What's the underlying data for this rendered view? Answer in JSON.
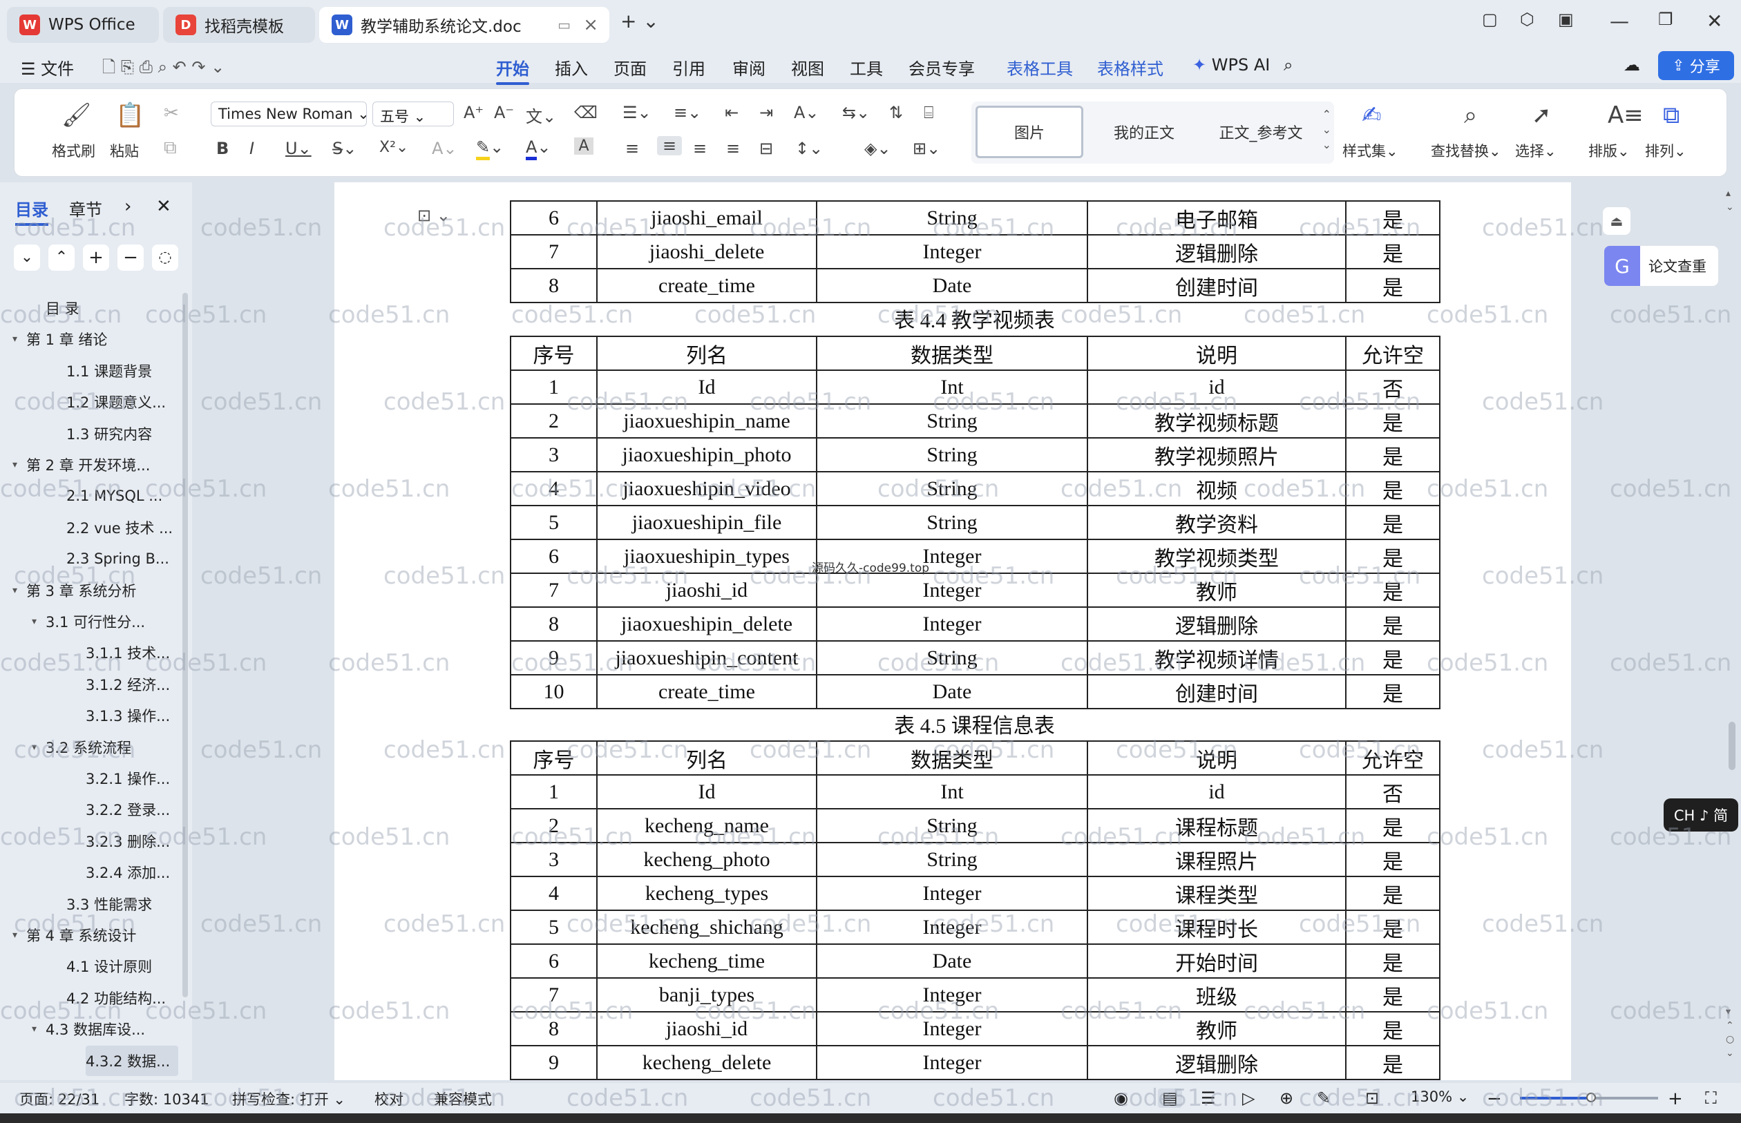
{
  "tabs": [
    {
      "label": "WPS Office",
      "icon": "wps-logo-icon"
    },
    {
      "label": "找稻壳模板",
      "icon": "docer-logo-icon"
    },
    {
      "label": "教学辅助系统论文.doc",
      "icon": "word-doc-icon"
    }
  ],
  "menu": {
    "file": "文件",
    "items": [
      "开始",
      "插入",
      "页面",
      "引用",
      "审阅",
      "视图",
      "工具",
      "会员专享",
      "表格工具",
      "表格样式"
    ],
    "wps_ai": "WPS AI",
    "share": "分享"
  },
  "ribbon": {
    "format_painter": "格式刷",
    "paste": "粘贴",
    "font_name": "Times New Roman",
    "font_size": "五号",
    "styles": [
      "图片",
      "我的正文",
      "正文_参考文"
    ],
    "style_set": "样式集",
    "find_replace": "查找替换",
    "select": "选择",
    "layout": "排版",
    "arrange": "排列"
  },
  "sidebar": {
    "tab_toc": "目录",
    "tab_chapter": "章节",
    "toc": [
      {
        "label": "目  录",
        "level": 0
      },
      {
        "label": "第 1 章  绪论",
        "level": 1
      },
      {
        "label": "1.1  课题背景",
        "level": 2
      },
      {
        "label": "1.2  课题意义...",
        "level": 2
      },
      {
        "label": "1.3  研究内容",
        "level": 2
      },
      {
        "label": "第 2 章  开发环境...",
        "level": 1
      },
      {
        "label": "2.1 MYSQL ...",
        "level": 2
      },
      {
        "label": "2.2 vue 技术  ...",
        "level": 2
      },
      {
        "label": "2.3 Spring B...",
        "level": 2
      },
      {
        "label": "第 3 章  系统分析",
        "level": 1
      },
      {
        "label": "3.1  可行性分...",
        "level": 2
      },
      {
        "label": "3.1.1  技术...",
        "level": 3
      },
      {
        "label": "3.1.2  经济...",
        "level": 3
      },
      {
        "label": "3.1.3  操作...",
        "level": 3
      },
      {
        "label": "3.2  系统流程",
        "level": 2
      },
      {
        "label": "3.2.1  操作...",
        "level": 3
      },
      {
        "label": "3.2.2  登录...",
        "level": 3
      },
      {
        "label": "3.2.3  删除...",
        "level": 3
      },
      {
        "label": "3.2.4  添加...",
        "level": 3
      },
      {
        "label": "3.3  性能需求",
        "level": 2
      },
      {
        "label": "第 4 章  系统设计",
        "level": 1
      },
      {
        "label": "4.1  设计原则",
        "level": 2
      },
      {
        "label": "4.2  功能结构...",
        "level": 2
      },
      {
        "label": "4.3  数据库设...",
        "level": 2
      },
      {
        "label": "4.3.2  数据...",
        "level": 3
      }
    ]
  },
  "doc": {
    "table1_rows": [
      [
        "6",
        "jiaoshi_email",
        "String",
        "电子邮箱",
        "是"
      ],
      [
        "7",
        "jiaoshi_delete",
        "Integer",
        "逻辑删除",
        "是"
      ],
      [
        "8",
        "create_time",
        "Date",
        "创建时间",
        "是"
      ]
    ],
    "caption2": "表 4.4 教学视频表",
    "table2_header": [
      "序号",
      "列名",
      "数据类型",
      "说明",
      "允许空"
    ],
    "table2_rows": [
      [
        "1",
        "Id",
        "Int",
        "id",
        "否"
      ],
      [
        "2",
        "jiaoxueshipin_name",
        "String",
        "教学视频标题",
        "是"
      ],
      [
        "3",
        "jiaoxueshipin_photo",
        "String",
        "教学视频照片",
        "是"
      ],
      [
        "4",
        "jiaoxueshipin_video",
        "String",
        "视频",
        "是"
      ],
      [
        "5",
        "jiaoxueshipin_file",
        "String",
        "教学资料",
        "是"
      ],
      [
        "6",
        "jiaoxueshipin_types",
        "Integer",
        "教学视频类型",
        "是"
      ],
      [
        "7",
        "jiaoshi_id",
        "Integer",
        "教师",
        "是"
      ],
      [
        "8",
        "jiaoxueshipin_delete",
        "Integer",
        "逻辑删除",
        "是"
      ],
      [
        "9",
        "jiaoxueshipin_content",
        "String",
        "教学视频详情",
        "是"
      ],
      [
        "10",
        "create_time",
        "Date",
        "创建时间",
        "是"
      ]
    ],
    "caption3": "表 4.5 课程信息表",
    "table3_header": [
      "序号",
      "列名",
      "数据类型",
      "说明",
      "允许空"
    ],
    "table3_rows": [
      [
        "1",
        "Id",
        "Int",
        "id",
        "否"
      ],
      [
        "2",
        "kecheng_name",
        "String",
        "课程标题",
        "是"
      ],
      [
        "3",
        "kecheng_photo",
        "String",
        "课程照片",
        "是"
      ],
      [
        "4",
        "kecheng_types",
        "Integer",
        "课程类型",
        "是"
      ],
      [
        "5",
        "kecheng_shichang",
        "Integer",
        "课程时长",
        "是"
      ],
      [
        "6",
        "kecheng_time",
        "Date",
        "开始时间",
        "是"
      ],
      [
        "7",
        "banji_types",
        "Integer",
        "班级",
        "是"
      ],
      [
        "8",
        "jiaoshi_id",
        "Integer",
        "教师",
        "是"
      ],
      [
        "9",
        "kecheng_delete",
        "Integer",
        "逻辑删除",
        "是"
      ]
    ],
    "overlay_text": "源码久久-code99.top",
    "watermark": "code51.cn"
  },
  "right_panel": {
    "plagiarism": "论文查重",
    "ime": "CH ♪ 简"
  },
  "status": {
    "page": "页面: 22/31",
    "words": "字数: 10341",
    "spell": "拼写检查: 打开",
    "proof": "校对",
    "compat": "兼容模式",
    "zoom": "130%"
  },
  "colors": {
    "accent": "#2f5ed1",
    "share_bg": "#2f6fe4",
    "chrome": "#e7ecf2"
  }
}
